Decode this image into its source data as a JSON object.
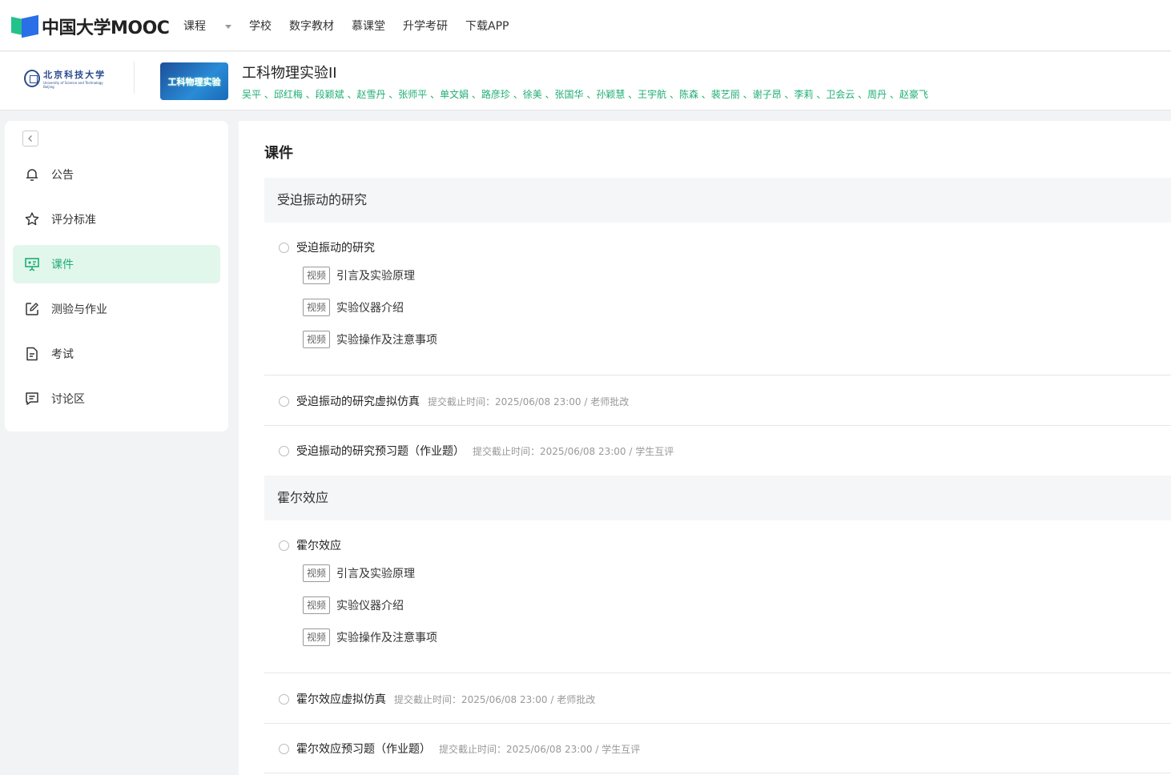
{
  "brand": {
    "name": "中国大学MOOC"
  },
  "nav": [
    "课程",
    "学校",
    "数字教材",
    "慕课堂",
    "升学考研",
    "下载APP"
  ],
  "school": {
    "name_cn": "北京科技大学",
    "name_en": "University of Science and Technology Beijing"
  },
  "course": {
    "cover_text": "工科物理实验",
    "title": "工科物理实验II",
    "teachers": "吴平 、邱红梅 、段颖斌 、赵雪丹 、张师平 、单文娟 、路彦珍 、徐美 、张国华 、孙颖慧 、王宇航 、陈森 、裴艺丽 、谢子昂 、李莉 、卫会云 、周丹 、赵豪飞"
  },
  "sidebar": {
    "items": [
      {
        "label": "公告",
        "icon": "bell-icon"
      },
      {
        "label": "评分标准",
        "icon": "star-icon"
      },
      {
        "label": "课件",
        "icon": "presentation-icon",
        "active": true
      },
      {
        "label": "测验与作业",
        "icon": "edit-icon"
      },
      {
        "label": "考试",
        "icon": "document-icon"
      },
      {
        "label": "讨论区",
        "icon": "chat-icon"
      }
    ]
  },
  "main": {
    "title": "课件",
    "sections": [
      {
        "title": "受迫振动的研究",
        "lesson": "受迫振动的研究",
        "units": [
          {
            "tag": "视频",
            "label": "引言及实验原理"
          },
          {
            "tag": "视频",
            "label": "实验仪器介绍"
          },
          {
            "tag": "视频",
            "label": "实验操作及注意事项"
          }
        ],
        "tasks": [
          {
            "label": "受迫振动的研究虚拟仿真",
            "meta": "提交截止时间：2025/06/08 23:00 / 老师批改"
          },
          {
            "label": "受迫振动的研究预习题（作业题）",
            "meta": "提交截止时间：2025/06/08 23:00 / 学生互评"
          }
        ]
      },
      {
        "title": "霍尔效应",
        "lesson": "霍尔效应",
        "units": [
          {
            "tag": "视频",
            "label": "引言及实验原理"
          },
          {
            "tag": "视频",
            "label": "实验仪器介绍"
          },
          {
            "tag": "视频",
            "label": "实验操作及注意事项"
          }
        ],
        "tasks": [
          {
            "label": "霍尔效应虚拟仿真",
            "meta": "提交截止时间：2025/06/08 23:00 / 老师批改"
          },
          {
            "label": "霍尔效应预习题（作业题）",
            "meta": "提交截止时间：2025/06/08 23:00 / 学生互评"
          }
        ]
      }
    ]
  }
}
